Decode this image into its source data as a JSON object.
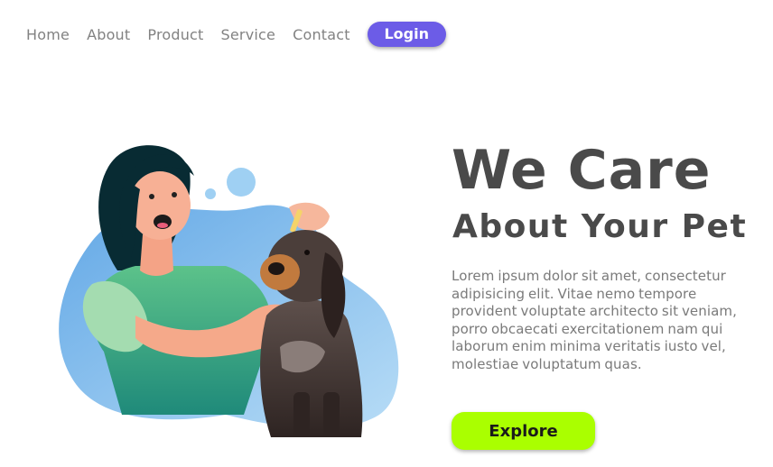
{
  "nav": {
    "items": [
      {
        "label": "Home"
      },
      {
        "label": "About"
      },
      {
        "label": "Product"
      },
      {
        "label": "Service"
      },
      {
        "label": "Contact"
      }
    ],
    "login_label": "Login"
  },
  "hero": {
    "title": "We Care",
    "subtitle": "About Your Pet",
    "body": "Lorem ipsum dolor sit amet, consectetur adipisicing elit. Vitae nemo tempore provident voluptate architecto sit veniam, porro obcaecati exercitationem nam qui laborum enim minima veritatis iusto vel, molestiae voluptatum quas.",
    "cta_label": "Explore"
  },
  "illustration": {
    "icon": "woman-with-dog-illustration"
  },
  "colors": {
    "login_bg": "#6c5ce7",
    "cta_bg": "#aaff00",
    "heading": "#4a4a4a",
    "body_text": "#7a7a7a",
    "nav_text": "#828282"
  }
}
